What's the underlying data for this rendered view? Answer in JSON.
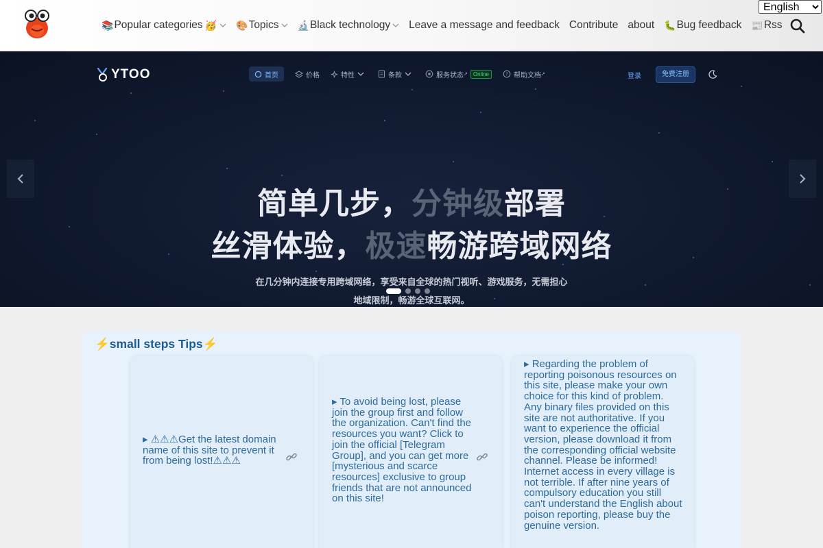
{
  "header": {
    "logo": "frog-mascot-logo",
    "nav": [
      {
        "emoji": "📚",
        "label": "Popular categories",
        "suffix": "🥳",
        "dropdown": true
      },
      {
        "emoji": "🎨",
        "label": "Topics",
        "suffix": "",
        "dropdown": true
      },
      {
        "emoji": "🔬",
        "label": "Black technology",
        "suffix": "",
        "dropdown": true
      },
      {
        "emoji": "",
        "label": "Leave a message and feedback",
        "suffix": "",
        "dropdown": false
      },
      {
        "emoji": "",
        "label": "Contribute",
        "suffix": "",
        "dropdown": false
      },
      {
        "emoji": "",
        "label": "about",
        "suffix": "",
        "dropdown": false
      },
      {
        "emoji": "🐛",
        "label": "Bug feedback",
        "suffix": "",
        "dropdown": false
      },
      {
        "emoji": "📰",
        "label": "Rss",
        "suffix": "",
        "dropdown": false
      }
    ],
    "language": {
      "selected": "English"
    },
    "search_icon": "search-icon"
  },
  "hero": {
    "brand": "YTOO",
    "menu": [
      {
        "label": "首页",
        "icon": "home-icon",
        "active": true
      },
      {
        "label": "价格",
        "icon": "layers-icon",
        "active": false
      },
      {
        "label": "特性",
        "icon": "sparkle-icon",
        "active": false,
        "dropdown": true
      },
      {
        "label": "条款",
        "icon": "document-icon",
        "active": false,
        "dropdown": true
      },
      {
        "label": "服务状态",
        "icon": "status-icon",
        "active": false,
        "external": "↗",
        "badge": "Online"
      },
      {
        "label": "帮助文档",
        "icon": "help-icon",
        "active": false,
        "external": "↗"
      }
    ],
    "login": "登录",
    "register": "免费注册",
    "line1": {
      "a": "简单几步，",
      "b": "分钟级",
      "c": "部署"
    },
    "line2": {
      "a": "丝滑体验，",
      "b": "极速",
      "c": "畅游跨域网络"
    },
    "subtitle": "在几分钟内连接专用跨域网络，享受来自全球的热门视听、游戏服务，无需担心地域限制，畅游全球互联网。",
    "slide_count": 4,
    "active_slide": 1
  },
  "tips": {
    "title": "⚡small steps Tips⚡",
    "items": [
      {
        "text": "▸ ⚠⚠⚠Get the latest domain name of this site to prevent it from being lost!⚠⚠⚠",
        "link_icon": "link-icon"
      },
      {
        "text": "▸ To avoid being lost, please join the group first and follow the organization. Can't find the resources you want? Click to join the official [Telegram Group], and you can get more [mysterious and scarce resources] exclusive to group friends that are not announced on this site!",
        "link_icon": "link-icon"
      },
      {
        "text": "▸ Regarding the problem of reporting poisonous resources on this site, please make your own choice for this kind of problem. Any binary files provided on this site are not authoritative. If you want to experience the official version, please download it from the corresponding official website channel. Please be informed! Internet access in every village is not terrible. If after nine years of compulsory education you still can't understand the English about poison reporting, please buy the genuine version."
      }
    ]
  }
}
